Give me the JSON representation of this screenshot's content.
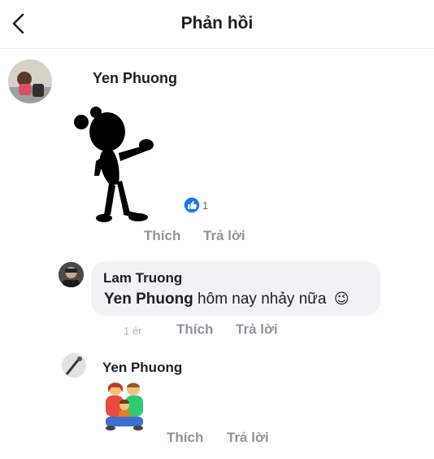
{
  "header": {
    "title": "Phản hồi",
    "back_icon": "chevron-left-icon"
  },
  "comments": [
    {
      "author": "Yen Phuong",
      "sticker": "dancing-silhouette-sticker",
      "reactions": {
        "icon": "like-icon",
        "count": "1"
      },
      "time": "",
      "actions": {
        "like": "Thích",
        "reply": "Trả lời"
      }
    },
    {
      "author": "Lam Truong",
      "mention": "Yen Phuong",
      "text": " hôm nay nhảy nữa",
      "emoji": "😉",
      "time": "1 ér",
      "actions": {
        "like": "Thích",
        "reply": "Trả lời"
      }
    },
    {
      "author": "Yen Phuong",
      "sticker": "family-sticker",
      "time": "",
      "actions": {
        "like": "Thích",
        "reply": "Trả lời"
      }
    }
  ],
  "colors": {
    "like_blue": "#1877f2",
    "muted_text": "#8d949e",
    "bubble_bg": "#f0f2f5"
  }
}
